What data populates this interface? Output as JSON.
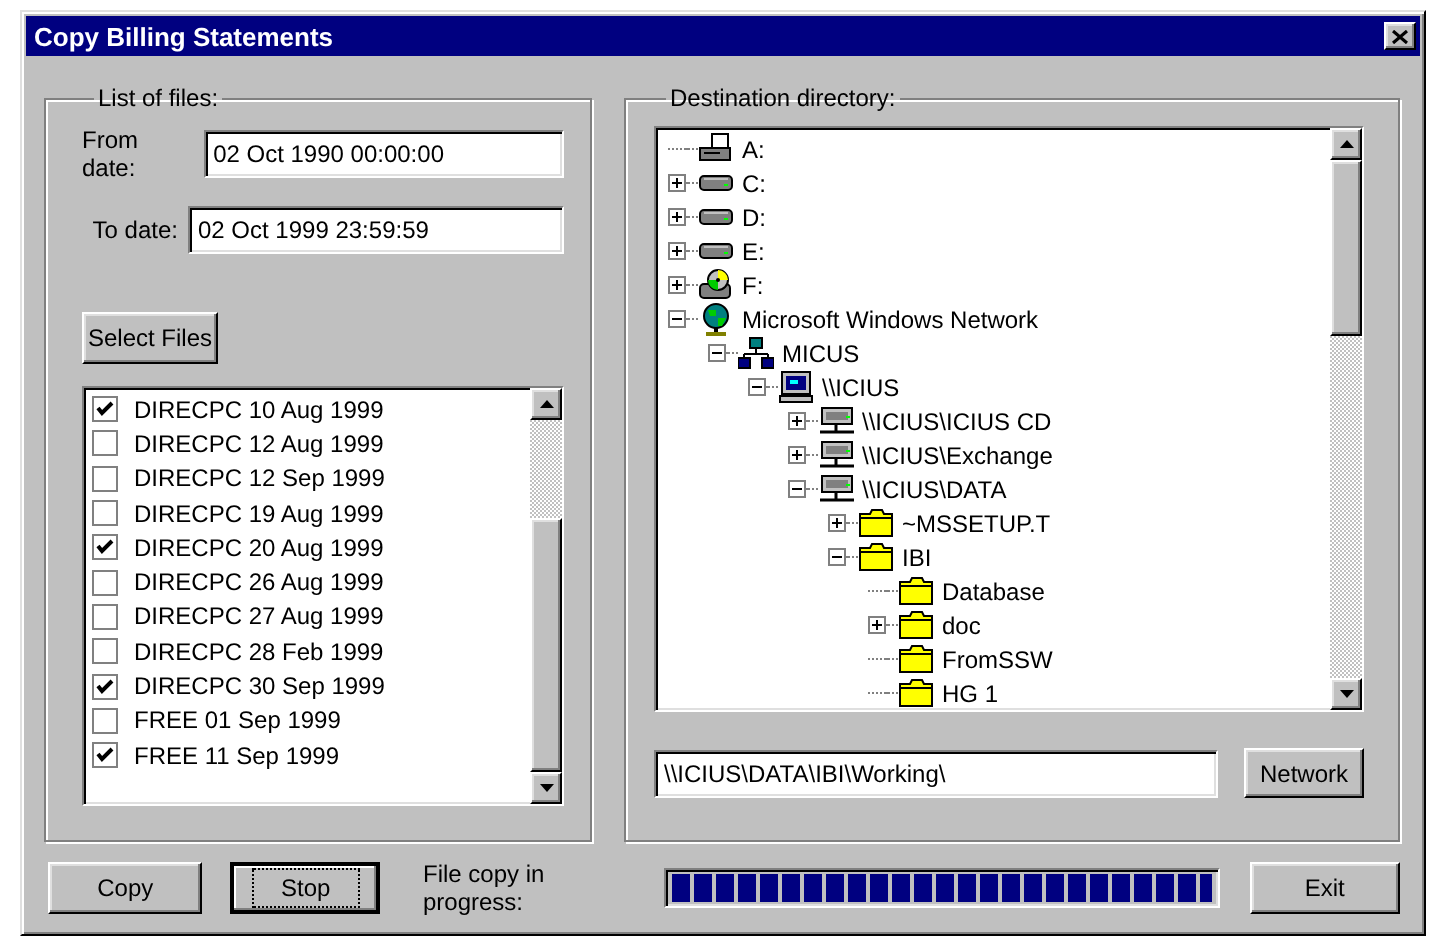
{
  "window": {
    "title": "Copy Billing Statements"
  },
  "files_group": {
    "label": "List of files:",
    "from_date": {
      "label": "From date:",
      "value": "02 Oct 1990 00:00:00"
    },
    "to_date": {
      "label": "To date:",
      "value": "02 Oct 1999 23:59:59"
    },
    "select_button": "Select Files",
    "files": [
      {
        "name": "DIRECPC 10 Aug 1999",
        "checked": true
      },
      {
        "name": "DIRECPC 12 Aug 1999",
        "checked": false
      },
      {
        "name": "DIRECPC 12 Sep 1999",
        "checked": false
      },
      {
        "name": "DIRECPC 19 Aug 1999",
        "checked": false
      },
      {
        "name": "DIRECPC 20 Aug 1999",
        "checked": true
      },
      {
        "name": "DIRECPC 26 Aug 1999",
        "checked": false
      },
      {
        "name": "DIRECPC 27 Aug 1999",
        "checked": false
      },
      {
        "name": "DIRECPC 28 Feb 1999",
        "checked": false
      },
      {
        "name": "DIRECPC 30 Sep 1999",
        "checked": true
      },
      {
        "name": "FREE 01 Sep 1999",
        "checked": false
      },
      {
        "name": "FREE 11 Sep 1999",
        "checked": true
      }
    ]
  },
  "destination_group": {
    "label": "Destination directory:",
    "tree": [
      {
        "label": "A:",
        "kind": "floppy"
      },
      {
        "label": "C:",
        "kind": "drive",
        "expanded": false
      },
      {
        "label": "D:",
        "kind": "drive",
        "expanded": false
      },
      {
        "label": "E:",
        "kind": "drive",
        "expanded": false
      },
      {
        "label": "F:",
        "kind": "cdrom",
        "expanded": false
      },
      {
        "label": "Microsoft Windows Network",
        "kind": "network",
        "expanded": true,
        "children": [
          {
            "label": "MICUS",
            "kind": "workgroup",
            "expanded": true,
            "children": [
              {
                "label": "\\\\ICIUS",
                "kind": "computer",
                "expanded": true,
                "children": [
                  {
                    "label": "\\\\ICIUS\\ICIUS CD",
                    "kind": "share",
                    "expanded": false
                  },
                  {
                    "label": "\\\\ICIUS\\Exchange",
                    "kind": "share",
                    "expanded": false
                  },
                  {
                    "label": "\\\\ICIUS\\DATA",
                    "kind": "share",
                    "expanded": true,
                    "children": [
                      {
                        "label": "~MSSETUP.T",
                        "kind": "folder",
                        "expanded": false
                      },
                      {
                        "label": "IBI",
                        "kind": "folder",
                        "expanded": true,
                        "children": [
                          {
                            "label": "Database",
                            "kind": "folder"
                          },
                          {
                            "label": "doc",
                            "kind": "folder",
                            "expanded": false
                          },
                          {
                            "label": "FromSSW",
                            "kind": "folder"
                          },
                          {
                            "label": "HG 1",
                            "kind": "folder"
                          }
                        ]
                      }
                    ]
                  }
                ]
              }
            ]
          }
        ]
      }
    ],
    "path": "\\\\ICIUS\\DATA\\IBI\\Working\\",
    "network_button": "Network"
  },
  "footer": {
    "copy_button": "Copy",
    "stop_button": {
      "label": "Stop",
      "focused": true
    },
    "progress": {
      "label": "File copy in progress:",
      "level": 1
    },
    "exit_button": "Exit"
  }
}
